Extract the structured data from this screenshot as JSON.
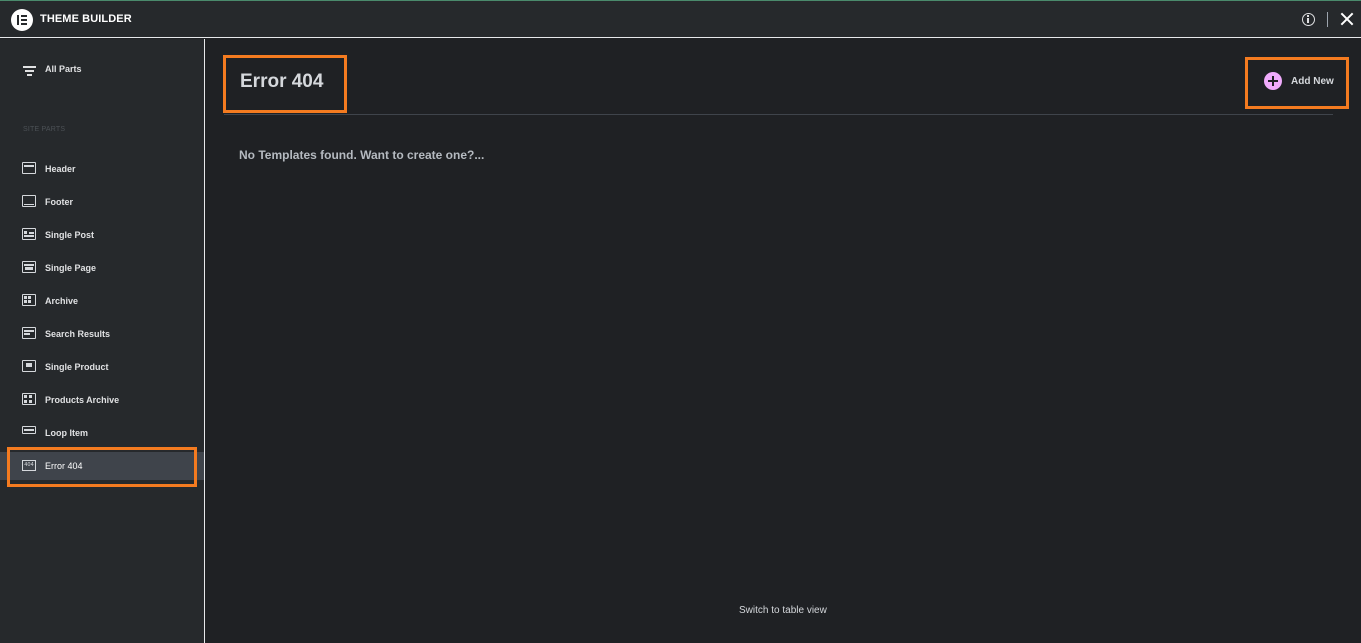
{
  "app": {
    "title": "THEME BUILDER"
  },
  "colors": {
    "accent": "#f0abfc",
    "highlight": "#f47b20",
    "background": "#1f2124",
    "sidebar": "#26292c"
  },
  "sidebar": {
    "all_parts_label": "All Parts",
    "section_label": "SITE PARTS",
    "items": [
      {
        "label": "Header",
        "icon": "header-icon"
      },
      {
        "label": "Footer",
        "icon": "footer-icon"
      },
      {
        "label": "Single Post",
        "icon": "single-post-icon"
      },
      {
        "label": "Single Page",
        "icon": "single-page-icon"
      },
      {
        "label": "Archive",
        "icon": "archive-icon"
      },
      {
        "label": "Search Results",
        "icon": "search-results-icon"
      },
      {
        "label": "Single Product",
        "icon": "single-product-icon"
      },
      {
        "label": "Products Archive",
        "icon": "products-archive-icon"
      },
      {
        "label": "Loop Item",
        "icon": "loop-item-icon"
      },
      {
        "label": "Error 404",
        "icon": "error-404-icon",
        "active": true,
        "icon_text": "404"
      }
    ]
  },
  "main": {
    "title": "Error 404",
    "add_new_label": "Add New",
    "empty_message": "No Templates found. Want to create one?...",
    "switch_view_label": "Switch to table view"
  }
}
